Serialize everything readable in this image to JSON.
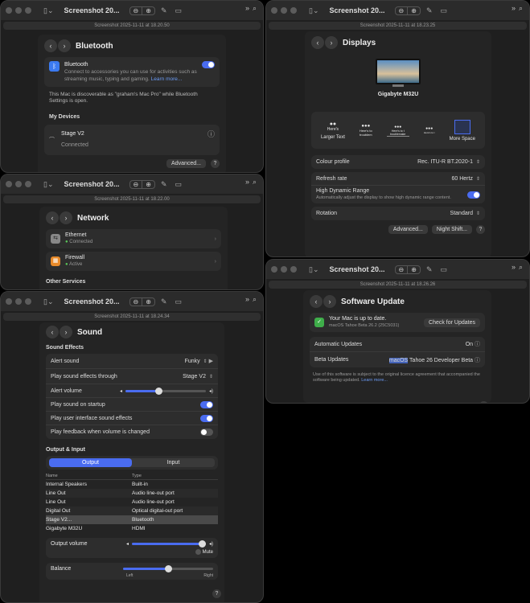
{
  "toolbar": {
    "title_short": "Screenshot 20...",
    "icon_grid": "▯⌄",
    "zoom_out": "⊖",
    "zoom_in": "⊕",
    "markup": "✎",
    "crop": "⌄",
    "more": "»",
    "search": "⌕"
  },
  "bluetooth": {
    "subtitle": "Screenshot 2025-11-11 at 18.20.50",
    "header": "Bluetooth",
    "toggle_title": "Bluetooth",
    "toggle_desc": "Connect to accessories you can use for activities such as streaming music, typing and gaming.",
    "learn_more": "Learn more...",
    "discoverable": "This Mac is discoverable as \"graham's Mac Pro\" while Bluetooth Settings is open.",
    "section": "My Devices",
    "device_name": "Stage V2",
    "device_status": "Connected",
    "advanced": "Advanced...",
    "help": "?"
  },
  "displays": {
    "subtitle": "Screenshot 2025-11-11 at 18.23.25",
    "header": "Displays",
    "monitor": "Gigabyte M32U",
    "res_left": "Larger Text",
    "res_right": "More Space",
    "preview_texts": [
      "Here's",
      "Here's to troublem",
      "Here's to t troublemake",
      "Here's to t",
      ""
    ],
    "rows": [
      {
        "label": "Colour profile",
        "value": "Rec. ITU-R BT.2020-1"
      },
      {
        "label": "Refresh rate",
        "value": "60 Hertz"
      }
    ],
    "hdr_label": "High Dynamic Range",
    "hdr_desc": "Automatically adjust the display to show high dynamic range content.",
    "rotation_label": "Rotation",
    "rotation_value": "Standard",
    "advanced": "Advanced...",
    "night_shift": "Night Shift...",
    "help": "?"
  },
  "network": {
    "subtitle": "Screenshot 2025-11-11 at 18.22.00",
    "header": "Network",
    "items": [
      {
        "name": "Ethernet",
        "status": "Connected"
      },
      {
        "name": "Firewall",
        "status": "Active"
      }
    ],
    "other": "Other Services"
  },
  "software_update": {
    "subtitle": "Screenshot 2025-11-11 at 18.26.26",
    "header": "Software Update",
    "status_title": "Your Mac is up to date.",
    "status_sub": "macOS Tahoe Beta 26.2 (25C5031)",
    "check_button": "Check for Updates",
    "auto_label": "Automatic Updates",
    "auto_value": "On",
    "beta_label": "Beta Updates",
    "beta_highlight": "macOS",
    "beta_value": "Tahoe 26 Developer Beta",
    "legal": "Use of this software is subject to the original licence agreement that accompanied the software being updated.",
    "learn_more": "Learn more...",
    "help": "?"
  },
  "sound": {
    "subtitle": "Screenshot 2025-11-11 at 18.24.34",
    "header": "Sound",
    "effects_section": "Sound Effects",
    "alert_sound_label": "Alert sound",
    "alert_sound_value": "Funky",
    "play_through_label": "Play sound effects through",
    "play_through_value": "Stage V2",
    "alert_volume_label": "Alert volume",
    "alert_volume_level": 0.42,
    "toggles": [
      {
        "label": "Play sound on startup",
        "on": true
      },
      {
        "label": "Play user interface sound effects",
        "on": true
      },
      {
        "label": "Play feedback when volume is changed",
        "on": false
      }
    ],
    "io_section": "Output & Input",
    "tab_output": "Output",
    "tab_input": "Input",
    "col_name": "Name",
    "col_type": "Type",
    "devices": [
      {
        "name": "Internal Speakers",
        "type": "Built-in"
      },
      {
        "name": "Line Out",
        "type": "Audio line-out port"
      },
      {
        "name": "Line Out",
        "type": "Audio line-out port"
      },
      {
        "name": "Digital Out",
        "type": "Optical digital-out port"
      },
      {
        "name": "Stage V2...",
        "type": "Bluetooth"
      },
      {
        "name": "Gigabyte M32U",
        "type": "HDMI"
      }
    ],
    "output_volume_label": "Output volume",
    "output_volume_level": 0.95,
    "mute": "Mute",
    "balance_label": "Balance",
    "balance_level": 0.5,
    "left": "Left",
    "right": "Right",
    "help": "?"
  }
}
